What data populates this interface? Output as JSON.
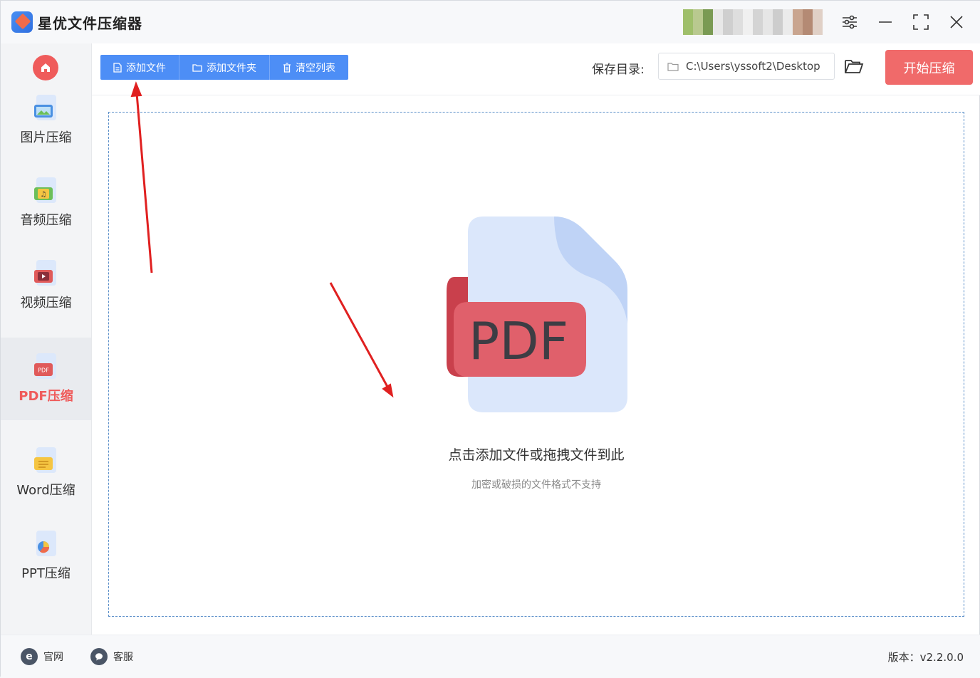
{
  "app": {
    "title": "星优文件压缩器"
  },
  "sidebar": {
    "items": [
      {
        "label": "图片压缩",
        "icon": "image-file-icon",
        "badge_color": "#4a90e2",
        "active": false
      },
      {
        "label": "音频压缩",
        "icon": "audio-file-icon",
        "badge_color": "#6cbf5a",
        "active": false
      },
      {
        "label": "视频压缩",
        "icon": "video-file-icon",
        "badge_color": "#e05a5a",
        "active": false
      },
      {
        "label": "PDF压缩",
        "icon": "pdf-file-icon",
        "badge_color": "#e05a5a",
        "active": true
      },
      {
        "label": "Word压缩",
        "icon": "word-file-icon",
        "badge_color": "#f5c542",
        "active": false
      },
      {
        "label": "PPT压缩",
        "icon": "ppt-file-icon",
        "badge_color": "#ef6b4a",
        "active": false
      }
    ]
  },
  "toolbar": {
    "add_file": "添加文件",
    "add_folder": "添加文件夹",
    "clear_list": "清空列表",
    "save_dir_label": "保存目录:",
    "save_dir_value": "C:\\Users\\yssoft2\\Desktop",
    "start_button": "开始压缩"
  },
  "dropzone": {
    "icon_text": "PDF",
    "hint": "点击添加文件或拖拽文件到此",
    "sub_hint": "加密或破损的文件格式不支持"
  },
  "footer": {
    "website": "官网",
    "support": "客服",
    "version": "版本：v2.2.0.0"
  },
  "colors": {
    "accent_blue": "#4d8ef6",
    "accent_red": "#f06a6a",
    "active_nav_text": "#ef5b5b"
  }
}
